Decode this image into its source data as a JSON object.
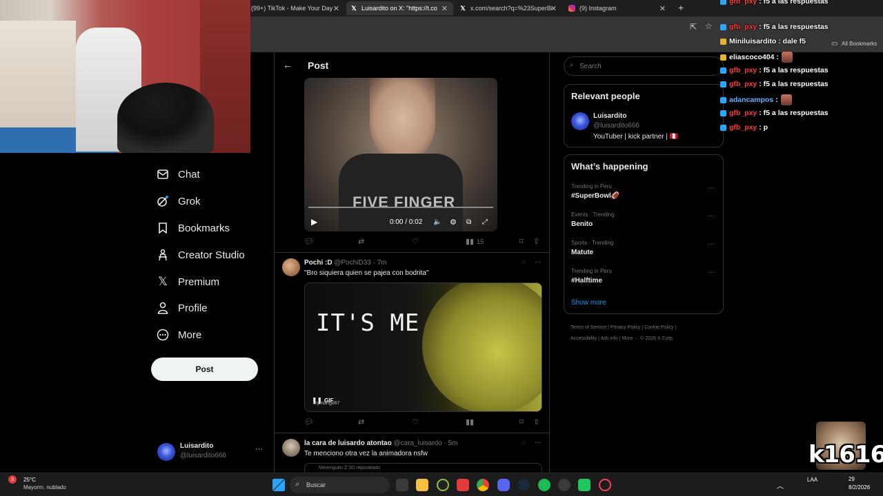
{
  "browser": {
    "tabs": [
      {
        "label": "(99+) TikTok - Make Your Day",
        "icon": "tiktok-icon"
      },
      {
        "label": "Luisardito on X: \"https://t.co/d",
        "icon": "x-icon"
      },
      {
        "label": "x.com/search?q=%23SuperBow",
        "icon": "x-icon"
      },
      {
        "label": "(9) Instagram",
        "icon": "instagram-icon"
      }
    ],
    "new_tab": "+",
    "bookmarks_label": "All Bookmarks"
  },
  "nav": {
    "items": [
      {
        "label": "Chat",
        "icon": "mail-icon"
      },
      {
        "label": "Grok",
        "icon": "grok-icon"
      },
      {
        "label": "Bookmarks",
        "icon": "bookmark-icon"
      },
      {
        "label": "Creator Studio",
        "icon": "creator-icon"
      },
      {
        "label": "Premium",
        "icon": "x-logo-icon"
      },
      {
        "label": "Profile",
        "icon": "person-icon"
      },
      {
        "label": "More",
        "icon": "more-circle-icon"
      }
    ],
    "post_button": "Post",
    "account": {
      "name": "Luisardito",
      "handle": "@luisardito666",
      "more": "···"
    }
  },
  "header": {
    "back": "←",
    "title": "Post"
  },
  "video": {
    "shirt_text": "FIVE FINGER",
    "time": "0:00 / 0:02"
  },
  "tweet1_actions": {
    "views": "15"
  },
  "tweet2": {
    "name": "Pochi :D",
    "handle": "@PochiD33",
    "time": "· 7m",
    "text": "\"Bro siquiera quien se pajea con bodrita\"",
    "gif_text": "IT'S ME",
    "gif_badge": "GIF",
    "gif_watermark": "mymango67"
  },
  "tweet3": {
    "name": "la cara de luisardo atontao",
    "handle": "@cara_luisardo",
    "time": "· 5m",
    "text": "Te menciono otra vez la animadora nsfw",
    "repost": "Merenguito Z 3D reposteado"
  },
  "right": {
    "search_placeholder": "Search",
    "relevant_title": "Relevant people",
    "person": {
      "name": "Luisardito",
      "handle": "@luisardito666",
      "bio": "YouTuber | kick partner | 🇵🇪"
    },
    "happening_title": "What’s happening",
    "trends": [
      {
        "meta": "Trending in Peru",
        "name": "#SuperBowl🏈"
      },
      {
        "meta": "Events · Trending",
        "name": "Benito"
      },
      {
        "meta": "Sports · Trending",
        "name": "Matute"
      },
      {
        "meta": "Trending in Peru",
        "name": "#Halftime"
      }
    ],
    "show_more": "Show more",
    "footer_line1": "Terms of Service  |  Privacy Policy  |  Cookie Policy  |",
    "footer_line2": "Accessibility  |  Ads info  |  More ···  © 2026 X Corp."
  },
  "chat": [
    {
      "user": "gfb_pxy",
      "msg": ": f5 a las respuestas",
      "color": "#ff3b3b",
      "badge": "blue"
    },
    {
      "user": "Miniluisardito",
      "msg": ": dale f5",
      "color": "#ffffff",
      "badge": "gold"
    },
    {
      "user": "eliascoco404",
      "msg": ":",
      "color": "#ffffff",
      "badge": "gold"
    },
    {
      "user": "gfb_pxy",
      "msg": ": f5 a las respuestas",
      "color": "#ff3b3b",
      "badge": "blue"
    },
    {
      "user": "gfb_pxy",
      "msg": ": f5 a las respuestas",
      "color": "#ff3b3b",
      "badge": "blue"
    },
    {
      "user": "adancampos",
      "msg": ":",
      "color": "#6ab0ff",
      "badge": "blue"
    },
    {
      "user": "gfb_pxy",
      "msg": ": f5 a las respuestas",
      "color": "#ff3b3b",
      "badge": "blue"
    },
    {
      "user": "gfb_pxy",
      "msg": ": p",
      "color": "#ff3b3b",
      "badge": "blue"
    }
  ],
  "chat_top": {
    "user": "gfb_pxy",
    "msg": ": f5 a las respuestas"
  },
  "overlay_logo": "k1616",
  "taskbar": {
    "weather_temp": "25°C",
    "weather_desc": "Mayorm. nublado",
    "weather_badge": "3",
    "search_placeholder": "Buscar",
    "lang": "LAA",
    "time": "29",
    "date": "8/2/2026"
  }
}
